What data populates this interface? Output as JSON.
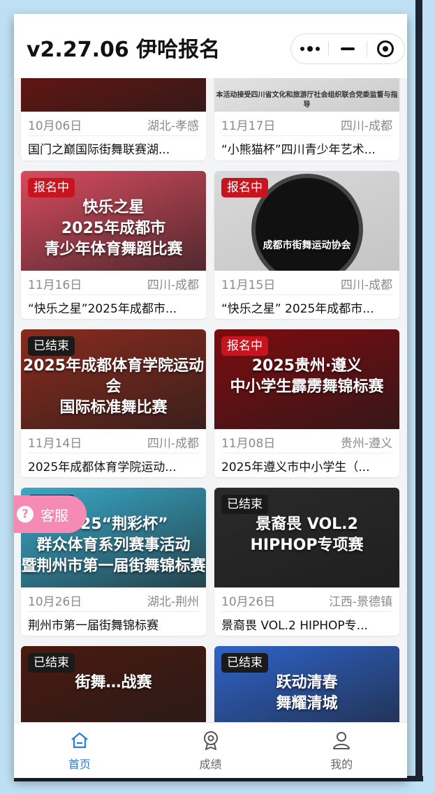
{
  "header": {
    "title": "v2.27.06 伊哈报名"
  },
  "capsule": {
    "more_icon": "more-dots-icon",
    "minimize_icon": "minimize-icon",
    "close_icon": "target-close-icon"
  },
  "cards": [
    {
      "date": "10月06日",
      "location": "湖北-孝感",
      "name": "国门之巅国际街舞联赛湖...",
      "badge": "",
      "cover_text": "",
      "cover_color": "#7a1410"
    },
    {
      "date": "11月17日",
      "location": "四川-成都",
      "name": "“小熊猫杯”四川青少年艺术...",
      "badge": "",
      "cover_text": "本活动接受四川省文化和旅游厅社会组织联合党委监督与指导",
      "cover_color": "#f1f1f1"
    },
    {
      "date": "11月16日",
      "location": "四川-成都",
      "name": "“快乐之星”2025年成都市...",
      "badge": "报名中",
      "badge_style": "red",
      "cover_text": "快乐之星\n2025年成都市\n青少年体育舞蹈比赛",
      "cover_color": "#d74b5e"
    },
    {
      "date": "11月15日",
      "location": "四川-成都",
      "name": "“快乐之星” 2025年成都市...",
      "badge": "报名中",
      "badge_style": "red",
      "cover_text": "成都市街舞运动协会",
      "cover_color": "#d9d9d9"
    },
    {
      "date": "11月14日",
      "location": "四川-成都",
      "name": "2025年成都体育学院运动...",
      "badge": "已结束",
      "badge_style": "black",
      "cover_text": "2025年成都体育学院运动会\n国际标准舞比赛",
      "cover_color": "#8a2b1e"
    },
    {
      "date": "11月08日",
      "location": "贵州-遵义",
      "name": "2025年遵义市中小学生（...",
      "badge": "报名中",
      "badge_style": "red",
      "cover_text": "2025贵州·遵义\n中小学生霹雳舞锦标赛",
      "cover_color": "#7d0c10"
    },
    {
      "date": "10月26日",
      "location": "湖北-荆州",
      "name": "荆州市第一届街舞锦标赛",
      "badge": "已结束",
      "badge_style": "black",
      "cover_text": "2025“荆彩杯”\n群众体育系列赛事活动\n暨荆州市第一届街舞锦标赛",
      "cover_color": "#3aa8c8"
    },
    {
      "date": "10月26日",
      "location": "江西-景德镇",
      "name": "景裔畏 VOL.2 HIPHOP专...",
      "badge": "已结束",
      "badge_style": "black",
      "cover_text": "景裔畏 VOL.2\nHIPHOP专项赛",
      "cover_color": "#2a2a2a"
    },
    {
      "date": "",
      "location": "",
      "name": "",
      "badge": "已结束",
      "badge_style": "black",
      "cover_text": "街舞…战赛",
      "cover_color": "#4a1a10"
    },
    {
      "date": "",
      "location": "",
      "name": "",
      "badge": "已结束",
      "badge_style": "black",
      "cover_text": "跃动清春\n舞耀清城",
      "cover_color": "#2f63c9"
    }
  ],
  "service": {
    "label": "客服",
    "icon": "question-icon"
  },
  "tabbar": [
    {
      "label": "首页",
      "icon": "home-icon",
      "active": true
    },
    {
      "label": "成绩",
      "icon": "medal-icon",
      "active": false
    },
    {
      "label": "我的",
      "icon": "user-icon",
      "active": false
    }
  ],
  "colors": {
    "accent": "#2b7cd8",
    "badge_red": "#c8141e",
    "badge_black": "#1a1a1a",
    "service_pink": "#f58bb5"
  }
}
